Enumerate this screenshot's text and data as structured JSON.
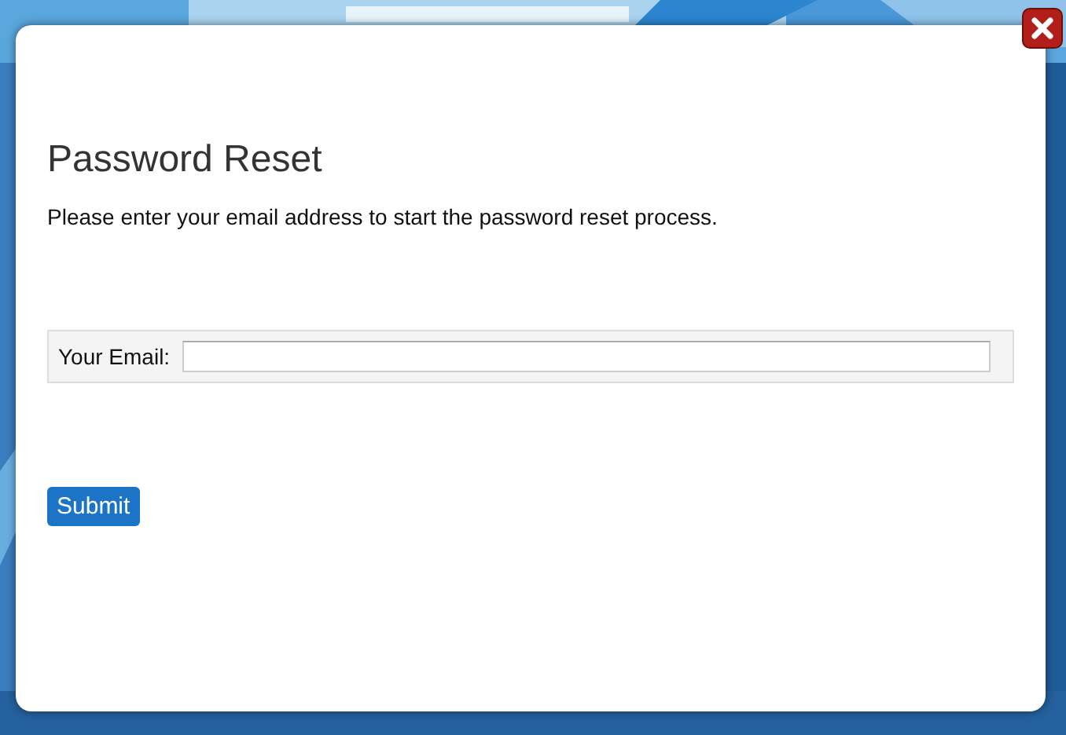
{
  "dialog": {
    "title": "Password Reset",
    "instructions": "Please enter your email address to start the password reset process.",
    "email_field": {
      "label": "Your Email:"
    },
    "submit_button": "Submit"
  }
}
